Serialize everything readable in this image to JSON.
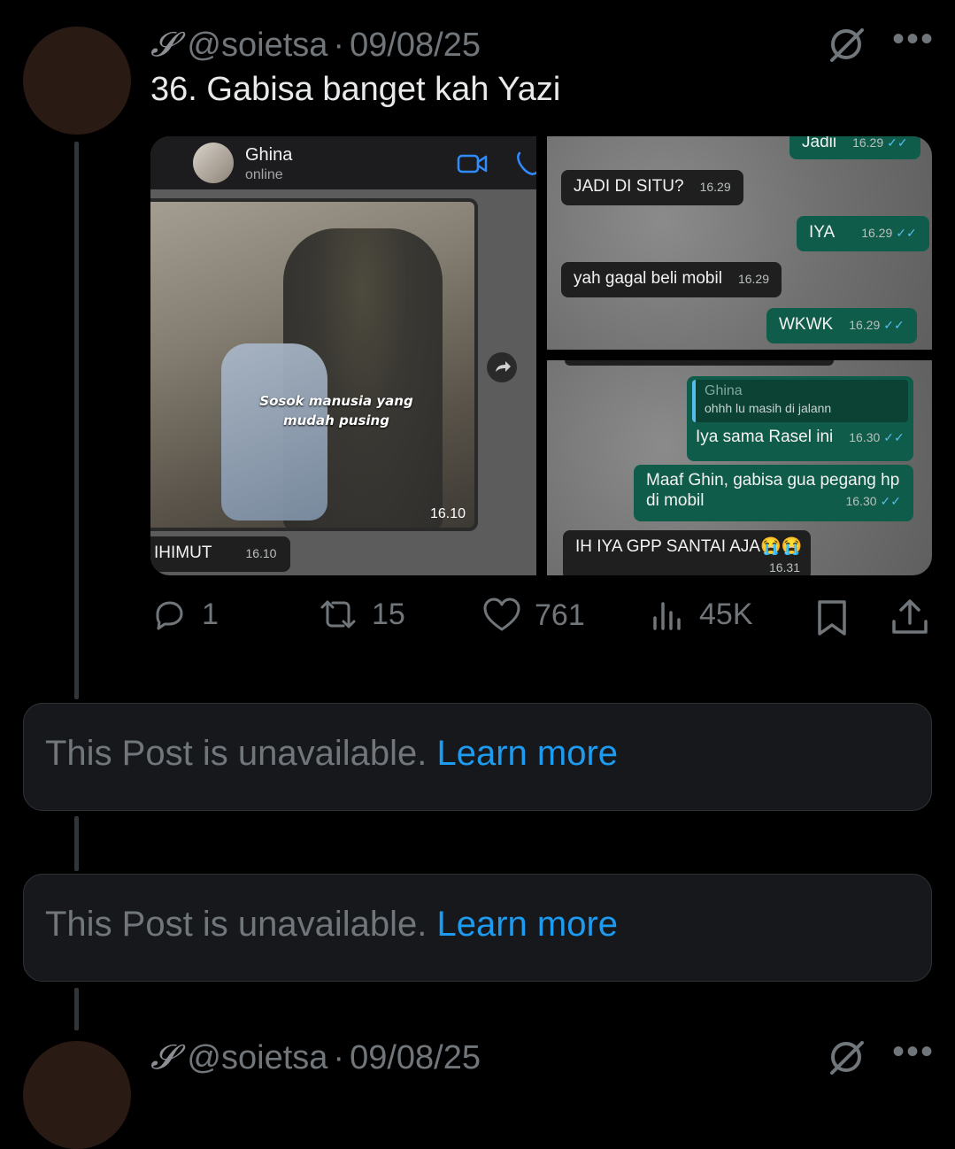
{
  "post": {
    "name_symbol": "𝓢",
    "handle": "@soietsa",
    "separator": "·",
    "date": "09/08/25",
    "text": "36. Gabisa banget kah Yazi",
    "icons": [
      "grok-icon",
      "more-icon"
    ]
  },
  "media": {
    "left_shot": {
      "contact_name": "Ghina",
      "contact_status": "online",
      "photo_caption_line1": "Sosok manusia yang",
      "photo_caption_line2": "mudah pusing",
      "photo_time": "16.10",
      "message_text": "IHIMUT",
      "message_time": "16.10"
    },
    "top_right_shot": {
      "messages": [
        {
          "dir": "out",
          "text": "Jadii",
          "time": "16.29"
        },
        {
          "dir": "in",
          "text": "JADI DI SITU?",
          "time": "16.29"
        },
        {
          "dir": "out",
          "text": "IYA",
          "time": "16.29"
        },
        {
          "dir": "in",
          "text": "yah gagal beli mobil",
          "time": "16.29"
        },
        {
          "dir": "out",
          "text": "WKWK",
          "time": "16.29"
        }
      ]
    },
    "bottom_right_shot": {
      "reply_quote_name": "Ghina",
      "reply_quote_text": "ohhh lu masih di jalann",
      "reply_text": "Iya sama Rasel ini",
      "reply_time": "16.30",
      "msg2_line1": "Maaf Ghin, gabisa gua pegang hp",
      "msg2_line2": "di mobil",
      "msg2_time": "16.30",
      "msg3_text": "IH IYA GPP SANTAI AJA😭😭",
      "msg3_time": "16.31"
    }
  },
  "actions": {
    "replies": "1",
    "reposts": "15",
    "likes": "761",
    "views": "45K"
  },
  "unavailable_posts": [
    {
      "text": "This Post is unavailable.",
      "link": "Learn more"
    },
    {
      "text": "This Post is unavailable.",
      "link": "Learn more"
    }
  ],
  "next_post": {
    "name_symbol": "𝓢",
    "handle": "@soietsa",
    "separator": "·",
    "date": "09/08/25"
  },
  "colors": {
    "background": "#000000",
    "muted": "#71767b",
    "link": "#1d9bf0",
    "outgoing_bubble": "#105c4a",
    "incoming_bubble": "#1f1f1f"
  }
}
